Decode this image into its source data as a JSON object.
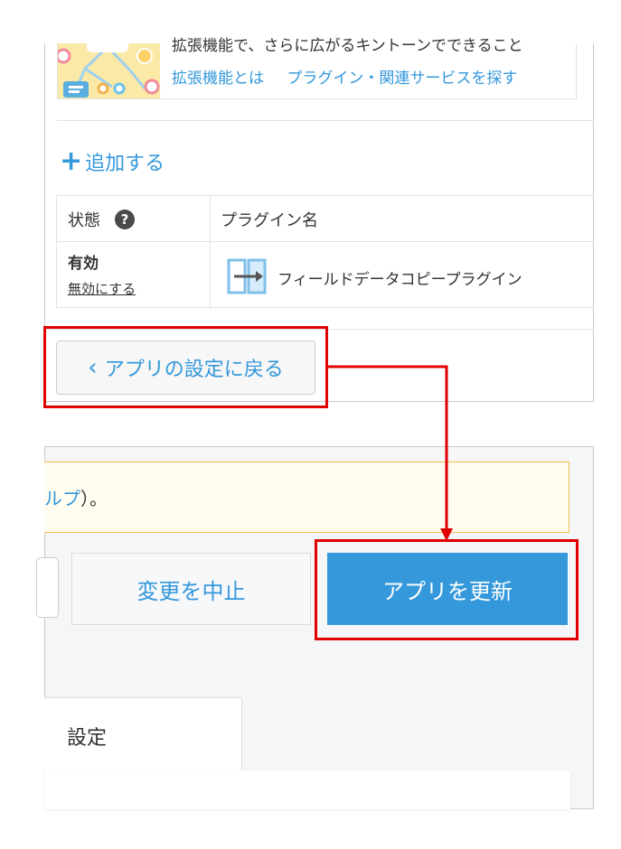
{
  "banner": {
    "text_cut": "拡張機能で、さらに広がるキントーンでできること",
    "links": [
      "拡張機能とは",
      "プラグイン・関連サービスを探す"
    ]
  },
  "plugins": {
    "add_label": "追加する",
    "table": {
      "col_status": "状態",
      "col_name": "プラグイン名",
      "row": {
        "status": "有効",
        "action": "無効にする",
        "name": "フィールドデータコピープラグイン"
      }
    },
    "back_label": "アプリの設定に戻る"
  },
  "settings": {
    "notice_link": "ルプ",
    "notice_tail": "）。",
    "cancel_label": "変更を中止",
    "update_label": "アプリを更新",
    "tab_label": "設定"
  },
  "colors": {
    "accent": "#3498db",
    "highlight": "#e00000",
    "notice_border": "#f2c14e"
  },
  "icons": [
    "plus-icon",
    "help-icon",
    "plugin-icon",
    "chevron-left-icon"
  ]
}
